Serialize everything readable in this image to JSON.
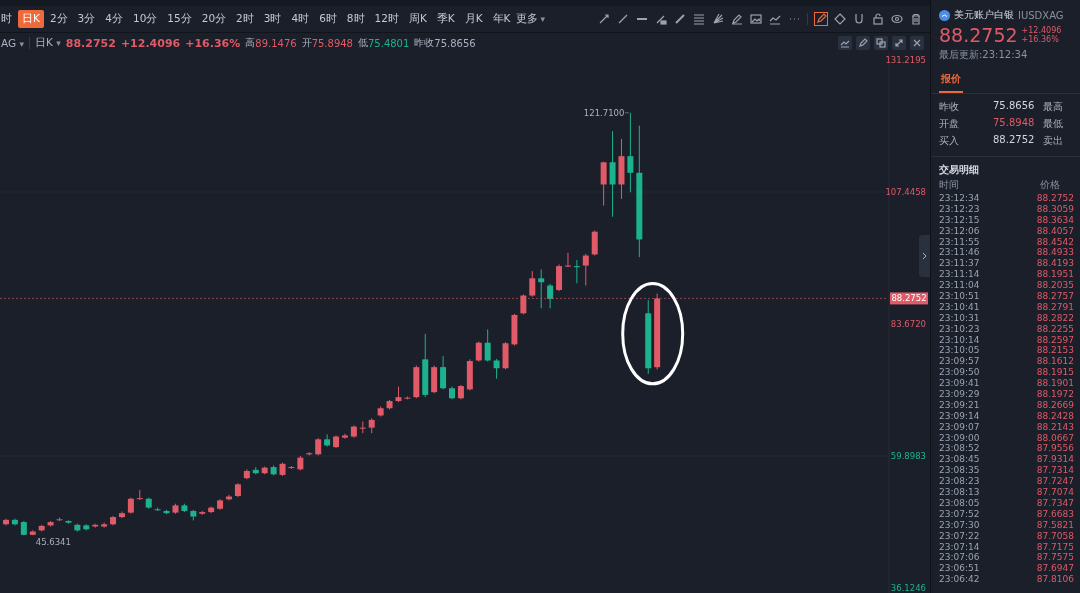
{
  "toolbar": {
    "periods": [
      {
        "label": "时",
        "selected": false
      },
      {
        "label": "日K",
        "selected": true
      },
      {
        "label": "2分",
        "selected": false
      },
      {
        "label": "3分",
        "selected": false
      },
      {
        "label": "4分",
        "selected": false
      },
      {
        "label": "10分",
        "selected": false
      },
      {
        "label": "15分",
        "selected": false
      },
      {
        "label": "20分",
        "selected": false
      },
      {
        "label": "2时",
        "selected": false
      },
      {
        "label": "3时",
        "selected": false
      },
      {
        "label": "4时",
        "selected": false
      },
      {
        "label": "6时",
        "selected": false
      },
      {
        "label": "8时",
        "selected": false
      },
      {
        "label": "12时",
        "selected": false
      },
      {
        "label": "周K",
        "selected": false
      },
      {
        "label": "季K",
        "selected": false
      },
      {
        "label": "月K",
        "selected": false
      },
      {
        "label": "年K",
        "selected": false
      }
    ],
    "more": "更多",
    "more_caret": "▾"
  },
  "info_bar": {
    "symbol": "AG",
    "symbol_caret": "▾",
    "period": "日K",
    "period_caret": "▾",
    "price": "88.2752",
    "change": "+12.4096",
    "change_pct": "+16.36%",
    "stats": [
      {
        "label": "高",
        "value": "89.1476",
        "kind": "up"
      },
      {
        "label": "开",
        "value": "75.8948",
        "kind": "up"
      },
      {
        "label": "低",
        "value": "75.4801",
        "kind": "down"
      },
      {
        "label": "昨收",
        "value": "75.8656",
        "kind": "flat"
      }
    ]
  },
  "chart": {
    "axis_labels": [
      {
        "label": "131.2195",
        "kind": "up"
      },
      {
        "label": "107.4458",
        "kind": "up"
      },
      {
        "label": "83.6720",
        "kind": "up"
      },
      {
        "label": "59.8983",
        "kind": "down"
      },
      {
        "label": "36.1246",
        "kind": "down"
      }
    ],
    "max_label": "121.7100",
    "min_label": "45.6341",
    "last_price": "88.2752"
  },
  "quote_panel": {
    "name": "美元账户白银",
    "code": "IUSDXAG",
    "price": "88.2752",
    "change": "+12.4096",
    "change_pct": "+16.36%",
    "updated": "最后更新:23:12:34",
    "tabs": [
      {
        "label": "报价",
        "selected": true
      }
    ],
    "quotes": [
      {
        "label": "昨收",
        "value": "75.8656",
        "kind": "flat",
        "label2": "最高"
      },
      {
        "label": "开盘",
        "value": "75.8948",
        "kind": "up",
        "label2": "最低"
      },
      {
        "label": "买入",
        "value": "88.2752",
        "kind": "flat",
        "label2": "卖出"
      }
    ],
    "trades_title": "交易明细",
    "columns": [
      "时间",
      "价格"
    ],
    "trades": [
      [
        "23:12:34",
        "88.2752"
      ],
      [
        "23:12:23",
        "88.3059"
      ],
      [
        "23:12:15",
        "88.3634"
      ],
      [
        "23:12:06",
        "88.4057"
      ],
      [
        "23:11:55",
        "88.4542"
      ],
      [
        "23:11:46",
        "88.4933"
      ],
      [
        "23:11:37",
        "88.4193"
      ],
      [
        "23:11:14",
        "88.1951"
      ],
      [
        "23:11:04",
        "88.2035"
      ],
      [
        "23:10:51",
        "88.2757"
      ],
      [
        "23:10:41",
        "88.2791"
      ],
      [
        "23:10:31",
        "88.2822"
      ],
      [
        "23:10:23",
        "88.2255"
      ],
      [
        "23:10:14",
        "88.2597"
      ],
      [
        "23:10:05",
        "88.2153"
      ],
      [
        "23:09:57",
        "88.1612"
      ],
      [
        "23:09:50",
        "88.1915"
      ],
      [
        "23:09:41",
        "88.1901"
      ],
      [
        "23:09:29",
        "88.1972"
      ],
      [
        "23:09:21",
        "88.2669"
      ],
      [
        "23:09:14",
        "88.2428"
      ],
      [
        "23:09:07",
        "88.2143"
      ],
      [
        "23:09:00",
        "88.0667"
      ],
      [
        "23:08:52",
        "87.9556"
      ],
      [
        "23:08:45",
        "87.9314"
      ],
      [
        "23:08:35",
        "87.7314"
      ],
      [
        "23:08:23",
        "87.7247"
      ],
      [
        "23:08:13",
        "87.7074"
      ],
      [
        "23:08:05",
        "87.7347"
      ],
      [
        "23:07:52",
        "87.6683"
      ],
      [
        "23:07:30",
        "87.5821"
      ],
      [
        "23:07:22",
        "87.7058"
      ],
      [
        "23:07:14",
        "87.7175"
      ],
      [
        "23:07:06",
        "87.7575"
      ],
      [
        "23:06:51",
        "87.6947"
      ],
      [
        "23:06:42",
        "87.8106"
      ]
    ]
  }
}
